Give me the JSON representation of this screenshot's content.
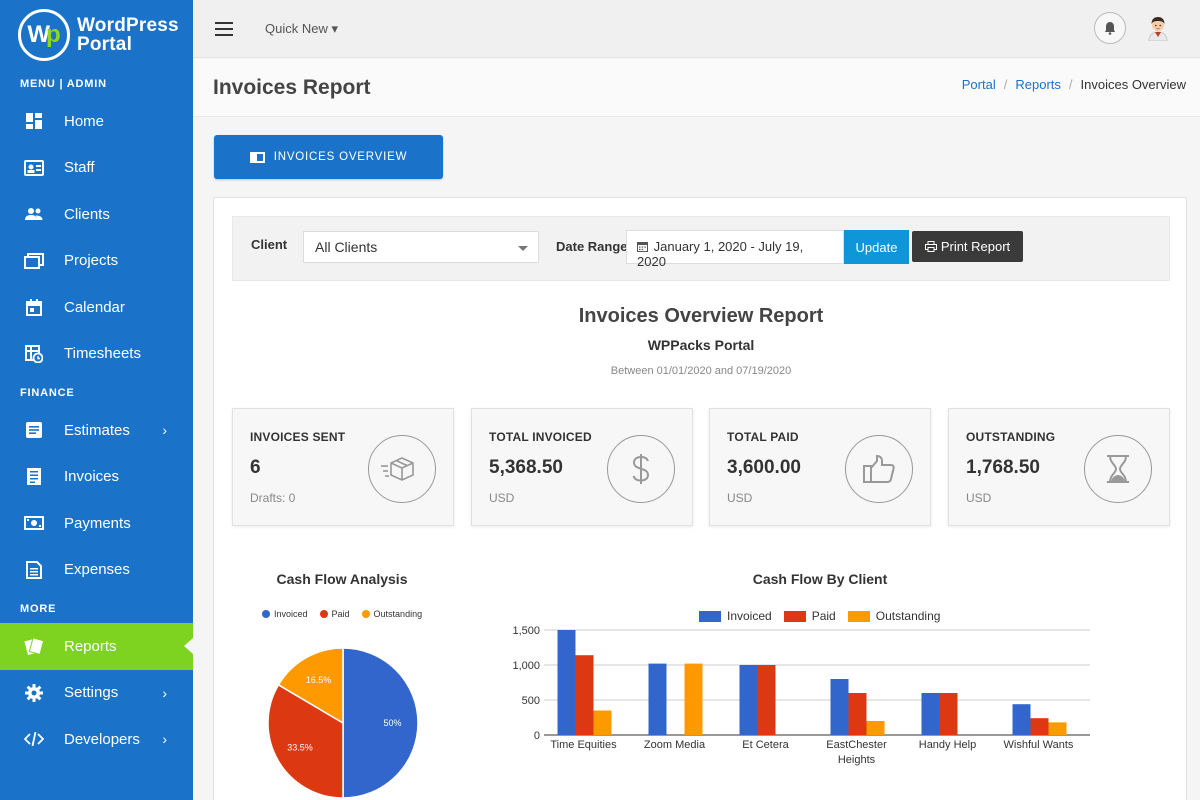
{
  "brand": {
    "line1": "WordPress",
    "line2": "Portal"
  },
  "sidebar": {
    "sections": {
      "menu": "MENU | ADMIN",
      "finance": "FINANCE",
      "more": "MORE"
    },
    "items": [
      {
        "label": "Home",
        "icon": "dashboard-icon"
      },
      {
        "label": "Staff",
        "icon": "id-card-icon"
      },
      {
        "label": "Clients",
        "icon": "people-icon"
      },
      {
        "label": "Projects",
        "icon": "folders-icon"
      },
      {
        "label": "Calendar",
        "icon": "calendar-icon"
      },
      {
        "label": "Timesheets",
        "icon": "timesheet-icon"
      },
      {
        "label": "Estimates",
        "icon": "estimate-icon"
      },
      {
        "label": "Invoices",
        "icon": "invoice-icon"
      },
      {
        "label": "Payments",
        "icon": "money-icon"
      },
      {
        "label": "Expenses",
        "icon": "receipt-icon"
      },
      {
        "label": "Reports",
        "icon": "report-icon",
        "active": true
      },
      {
        "label": "Settings",
        "icon": "gear-icon"
      },
      {
        "label": "Developers",
        "icon": "code-icon"
      }
    ],
    "chevron": "›"
  },
  "topbar": {
    "quick_new": "Quick New ▾"
  },
  "header": {
    "title": "Invoices Report",
    "breadcrumb": [
      "Portal",
      "Reports",
      "Invoices Overview"
    ],
    "separator": "/"
  },
  "overview_button": "INVOICES OVERVIEW",
  "filters": {
    "client_label": "Client",
    "client_value": "All Clients",
    "date_label": "Date Range",
    "date_value": "January 1, 2020 - July 19, 2020",
    "update": "Update",
    "print": "Print Report"
  },
  "report": {
    "title": "Invoices Overview Report",
    "subtitle": "WPPacks Portal",
    "range": "Between 01/01/2020 and 07/19/2020"
  },
  "stats": [
    {
      "title": "INVOICES SENT",
      "value": "6",
      "sub": "Drafts: 0",
      "icon": "package-icon"
    },
    {
      "title": "TOTAL INVOICED",
      "value": "5,368.50",
      "sub": "USD",
      "icon": "dollar-icon"
    },
    {
      "title": "TOTAL PAID",
      "value": "3,600.00",
      "sub": "USD",
      "icon": "thumbs-up-icon"
    },
    {
      "title": "OUTSTANDING",
      "value": "1,768.50",
      "sub": "USD",
      "icon": "hourglass-icon"
    }
  ],
  "colors": {
    "invoiced": "#3366cc",
    "paid": "#dc3912",
    "outstanding": "#ff9900",
    "sidebar": "#1a73c9",
    "active": "#7ed321"
  },
  "chart_data": [
    {
      "type": "pie",
      "title": "Cash Flow Analysis",
      "labels": [
        "Invoiced",
        "Paid",
        "Outstanding"
      ],
      "values": [
        50,
        33.5,
        16.5
      ],
      "value_labels": [
        "50%",
        "33.5%",
        "16.5%"
      ],
      "legend": "top"
    },
    {
      "type": "bar",
      "title": "Cash Flow By Client",
      "categories": [
        "Time Equities",
        "Zoom Media",
        "Et Cetera",
        "EastChester Heights",
        "Handy Help",
        "Wishful Wants"
      ],
      "category_lines": [
        [
          "Time Equities"
        ],
        [
          "Zoom Media"
        ],
        [
          "Et Cetera"
        ],
        [
          "EastChester",
          "Heights"
        ],
        [
          "Handy Help"
        ],
        [
          "Wishful Wants"
        ]
      ],
      "series": [
        {
          "name": "Invoiced",
          "values": [
            1500,
            1020,
            1000,
            800,
            600,
            440
          ]
        },
        {
          "name": "Paid",
          "values": [
            1140,
            0,
            1000,
            600,
            600,
            240
          ]
        },
        {
          "name": "Outstanding",
          "values": [
            350,
            1020,
            0,
            200,
            0,
            180
          ]
        }
      ],
      "ylim": [
        0,
        1500
      ],
      "yticks": [
        0,
        500,
        1000,
        1500
      ],
      "ytick_labels": [
        "0",
        "500",
        "1,000",
        "1,500"
      ],
      "grid": true,
      "legend": "top"
    }
  ]
}
